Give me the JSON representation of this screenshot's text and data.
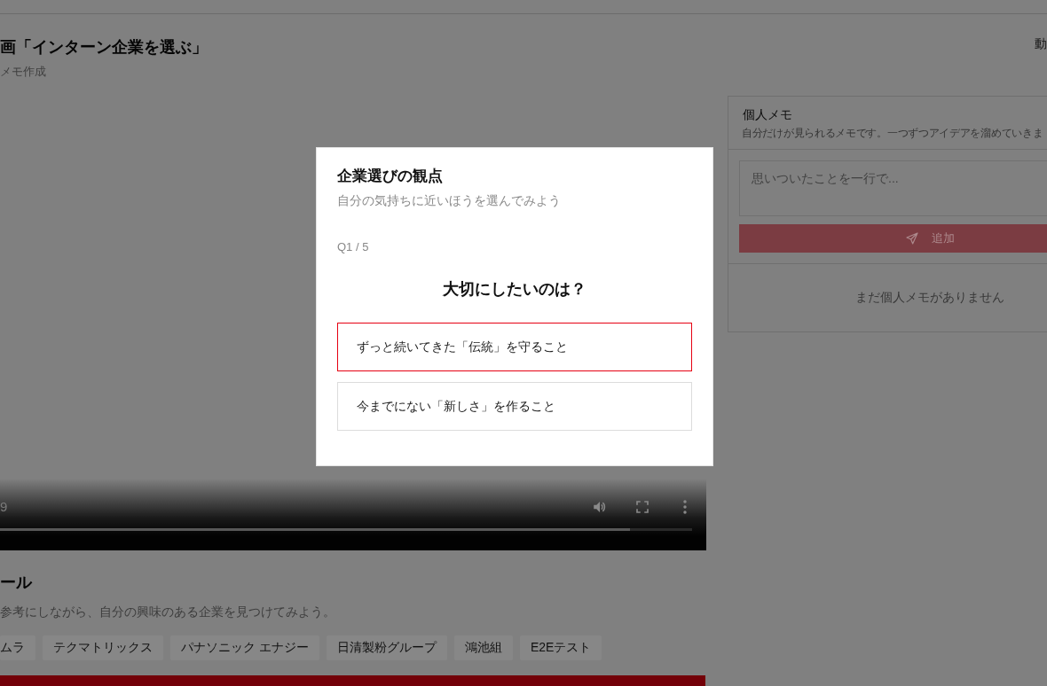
{
  "header": {
    "title": "画「インターン企業を選ぶ」",
    "subtitle": "メモ作成",
    "link": "動"
  },
  "video": {
    "time": "9",
    "progress": {
      "level": 0.91
    }
  },
  "companies": {
    "heading": "ール",
    "description": "参考にしながら、自分の興味のある企業を見つけてみよう。",
    "chips": [
      "ムラ",
      "テクマトリックス",
      "パナソニック エナジー",
      "日清製粉グループ",
      "鴻池組",
      "E2Eテスト"
    ]
  },
  "memo": {
    "title": "個人メモ",
    "description": "自分だけが見られるメモです。一つずつアイデアを溜めていきま",
    "input": {
      "placeholder": "思いついたことを一行で..."
    },
    "add_button": {
      "label": "追加",
      "disabled": true
    },
    "empty": "まだ個人メモがありません"
  },
  "modal": {
    "title": "企業選びの観点",
    "subtitle": "自分の気持ちに近いほうを選んでみよう",
    "counter": "Q1 / 5",
    "question": "大切にしたいのは？",
    "options": [
      {
        "label": "ずっと続いてきた「伝統」を守ること",
        "selected": true
      },
      {
        "label": "今までにない「新しさ」を作ること",
        "selected": false
      }
    ]
  }
}
